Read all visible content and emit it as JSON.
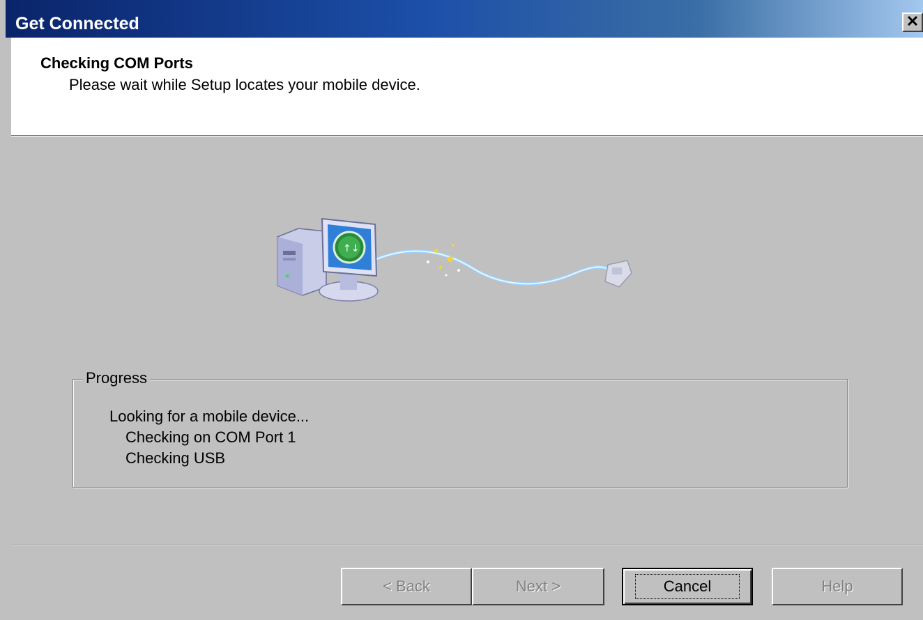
{
  "window": {
    "title": "Get Connected"
  },
  "header": {
    "title": "Checking COM Ports",
    "subtitle": "Please wait while Setup locates your mobile device."
  },
  "progress": {
    "group_label": "Progress",
    "lines": [
      "Looking for a mobile device...",
      "Checking on COM Port 1",
      "Checking USB"
    ]
  },
  "buttons": {
    "back": "< Back",
    "next": "Next >",
    "cancel": "Cancel",
    "help": "Help"
  },
  "icons": {
    "close": "close-icon",
    "illustration": "computer-connecting-to-device-illustration"
  },
  "colors": {
    "titlebar_start": "#0a246a",
    "titlebar_end": "#a6caf0",
    "dialog_face": "#c0c0c0",
    "header_bg": "#ffffff"
  }
}
